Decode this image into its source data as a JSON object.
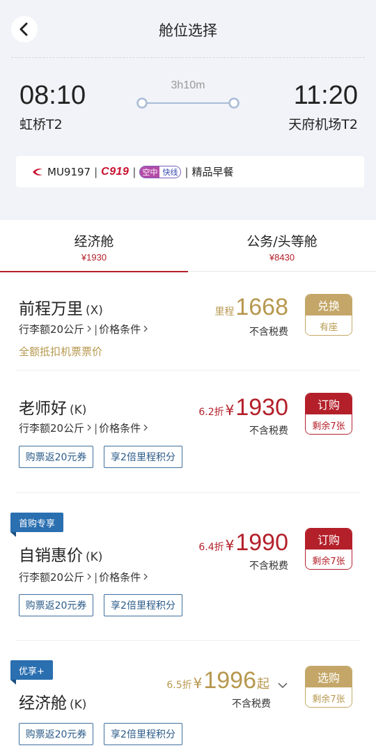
{
  "header": {
    "title": "舱位选择"
  },
  "flight": {
    "dep_time": "08:10",
    "dep_airport": "虹桥T2",
    "duration": "3h10m",
    "arr_time": "11:20",
    "arr_airport": "天府机场T2",
    "flight_no": "MU9197",
    "aircraft": "C919",
    "express_a": "空中",
    "express_b": "快线",
    "meal": "精品早餐",
    "sep": "|"
  },
  "tabs": [
    {
      "label": "经济舱",
      "price": "¥1930",
      "active": true
    },
    {
      "label": "公务/头等舱",
      "price": "¥8430",
      "active": false
    }
  ],
  "fares": [
    {
      "name": "前程万里",
      "class": "(X)",
      "baggage": "行李额20公斤",
      "conditions": "价格条件",
      "price_prefix": "里程",
      "price": "1668",
      "tax": "不含税费",
      "btn_main": "兑换",
      "btn_sub": "有座",
      "note": "全额抵扣机票票价"
    },
    {
      "name": "老师好",
      "class": "(K)",
      "baggage": "行李额20公斤",
      "conditions": "价格条件",
      "discount": "6.2折",
      "currency": "¥",
      "price": "1930",
      "tax": "不含税费",
      "btn_main": "订购",
      "btn_sub": "剩余7张",
      "tags": [
        "购票返20元券",
        "享2倍里程积分"
      ]
    },
    {
      "ribbon": "首购专享",
      "name": "自销惠价",
      "class": "(K)",
      "baggage": "行李额20公斤",
      "conditions": "价格条件",
      "discount": "6.4折",
      "currency": "¥",
      "price": "1990",
      "tax": "不含税费",
      "btn_main": "订购",
      "btn_sub": "剩余7张",
      "tags": [
        "购票返20元券",
        "享2倍里程积分"
      ]
    },
    {
      "ribbon": "优享+",
      "name": "经济舱",
      "class": "(K)",
      "discount": "6.5折",
      "currency": "¥",
      "price": "1996",
      "suffix": "起",
      "tax": "不含税费",
      "btn_main": "选购",
      "btn_sub": "剩余7张",
      "tags": [
        "购票返20元券",
        "享2倍里程积分"
      ]
    }
  ],
  "colors": {
    "accent_red": "#b4202a",
    "accent_gold": "#b7984f",
    "tag_blue": "#2a5a88",
    "background": "#f1f3f8"
  },
  "icons": {
    "back": "chevron-left-icon",
    "airline": "china-eastern-logo-icon",
    "more": "chevron-right-icon",
    "expand": "chevron-down-icon"
  }
}
